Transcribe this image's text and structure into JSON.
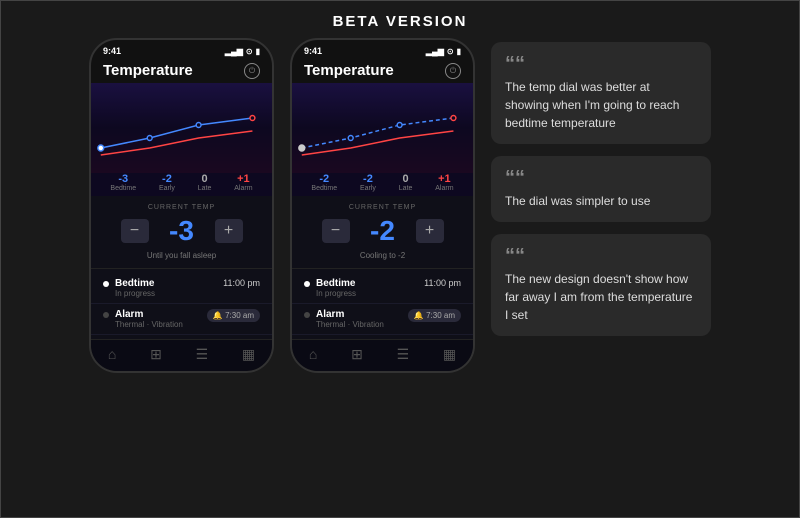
{
  "page": {
    "title": "BETA VERSION",
    "background": "#1a1a1a"
  },
  "phones": [
    {
      "id": "phone1",
      "statusBar": {
        "time": "9:41",
        "signal": "▂▄▆",
        "wifi": "wifi",
        "battery": "🔋"
      },
      "header": {
        "title": "Temperature"
      },
      "chartLabels": [
        {
          "value": "-3",
          "color": "blue",
          "name": "Bedtime"
        },
        {
          "value": "-2",
          "color": "blue",
          "name": "Early"
        },
        {
          "value": "0",
          "color": "white",
          "name": "Late"
        },
        {
          "value": "+1",
          "color": "red",
          "name": "Alarm"
        }
      ],
      "currentTemp": {
        "label": "CURRENT TEMP",
        "value": "-3",
        "subtext": "Until you fall asleep"
      },
      "schedule": [
        {
          "name": "Bedtime",
          "sub": "In progress",
          "time": "11:00 pm",
          "active": true
        },
        {
          "name": "Alarm",
          "sub": "Thermal · Vibration",
          "timeBadge": "🔔 7:30 am",
          "active": false
        }
      ]
    },
    {
      "id": "phone2",
      "statusBar": {
        "time": "9:41"
      },
      "header": {
        "title": "Temperature"
      },
      "chartLabels": [
        {
          "value": "-2",
          "color": "blue",
          "name": "Bedtime"
        },
        {
          "value": "-2",
          "color": "blue",
          "name": "Early"
        },
        {
          "value": "0",
          "color": "white",
          "name": "Late"
        },
        {
          "value": "+1",
          "color": "red",
          "name": "Alarm"
        }
      ],
      "currentTemp": {
        "label": "CURRENT TEMP",
        "value": "-2",
        "subtext": "Cooling to -2"
      },
      "schedule": [
        {
          "name": "Bedtime",
          "sub": "In progress",
          "time": "11:00 pm",
          "active": true
        },
        {
          "name": "Alarm",
          "sub": "Thermal · Vibration",
          "timeBadge": "🔔 7:30 am",
          "active": false
        }
      ]
    }
  ],
  "quotes": [
    {
      "id": "quote1",
      "mark": "““",
      "text": "The temp dial was better at showing when I'm going to reach bedtime temperature"
    },
    {
      "id": "quote2",
      "mark": "““",
      "text": "The dial was simpler to use"
    },
    {
      "id": "quote3",
      "mark": "““",
      "text": "The new design doesn't show how far away I am from the temperature I set"
    }
  ],
  "navIcons": [
    "⌂",
    "⊞",
    "☰",
    "📊"
  ]
}
